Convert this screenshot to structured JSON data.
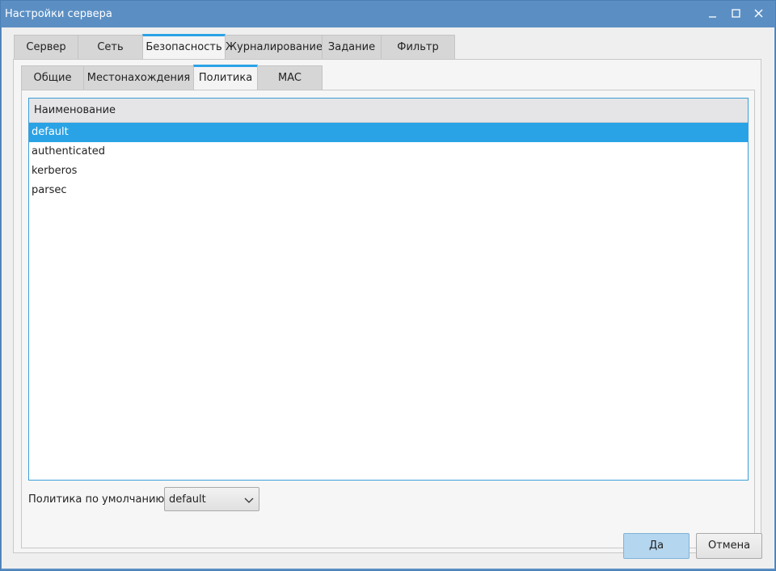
{
  "window": {
    "title": "Настройки сервера"
  },
  "tabs": [
    {
      "label": "Сервер"
    },
    {
      "label": "Сеть"
    },
    {
      "label": "Безопасность"
    },
    {
      "label": "Журналирование"
    },
    {
      "label": "Задание"
    },
    {
      "label": "Фильтр"
    }
  ],
  "active_tab": "Безопасность",
  "subtabs": [
    {
      "label": "Общие"
    },
    {
      "label": "Местонахождения"
    },
    {
      "label": "Политика"
    },
    {
      "label": "MAC"
    }
  ],
  "active_subtab": "Политика",
  "policy_list": {
    "header": "Наименование",
    "items": [
      "default",
      "authenticated",
      "kerberos",
      "parsec"
    ],
    "selected": "default"
  },
  "default_policy": {
    "label": "Политика по умолчанию:",
    "value": "default"
  },
  "buttons": {
    "ok": "Да",
    "cancel": "Отмена"
  },
  "colors": {
    "titlebar": "#5b8fc4",
    "accent": "#2aa3e6",
    "primary_button": "#b4d6ef"
  }
}
